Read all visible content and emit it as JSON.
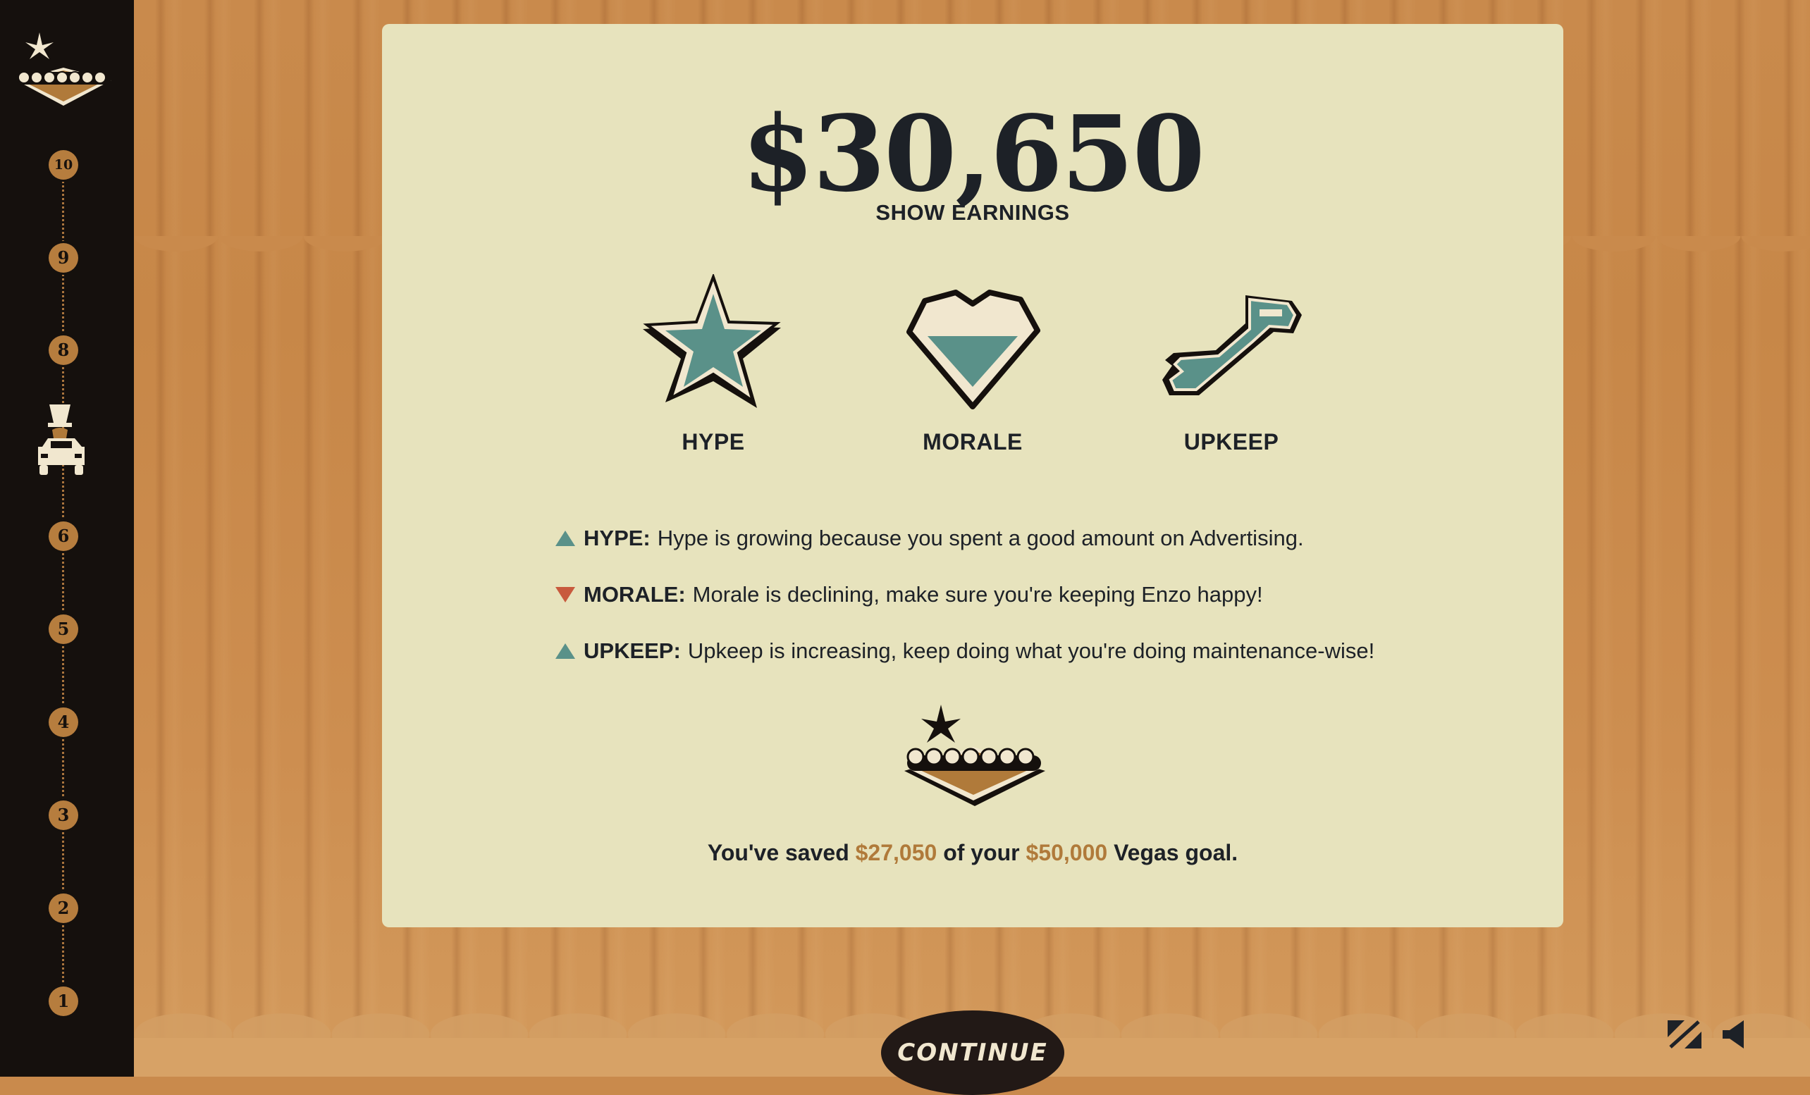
{
  "sidebar": {
    "levels": [
      "10",
      "9",
      "8",
      "6",
      "5",
      "4",
      "3",
      "2",
      "1"
    ]
  },
  "results": {
    "earnings_amount": "$30,650",
    "earnings_label": "SHOW EARNINGS",
    "stats": [
      {
        "label": "HYPE",
        "icon": "star-icon"
      },
      {
        "label": "MORALE",
        "icon": "heart-icon"
      },
      {
        "label": "UPKEEP",
        "icon": "wrench-icon"
      }
    ],
    "messages": [
      {
        "trend": "up",
        "key": "HYPE:",
        "text": "Hype is growing because you spent a good amount on Advertising."
      },
      {
        "trend": "down",
        "key": "MORALE:",
        "text": "Morale is declining, make sure you're keeping Enzo happy!"
      },
      {
        "trend": "up",
        "key": "UPKEEP:",
        "text": "Upkeep is increasing, keep doing what you're doing maintenance-wise!"
      }
    ],
    "goal": {
      "prefix": "You've saved",
      "saved": "$27,050",
      "middle": "of your",
      "target": "$50,000",
      "suffix": "Vegas goal."
    }
  },
  "controls": {
    "continue_label": "CONTINUE"
  },
  "colors": {
    "teal": "#5a9189",
    "down_red": "#c85a3d",
    "money_gold": "#b07a3a",
    "ink": "#1d2127",
    "card": "#e7e3bd",
    "curtain": "#c98a4c"
  }
}
